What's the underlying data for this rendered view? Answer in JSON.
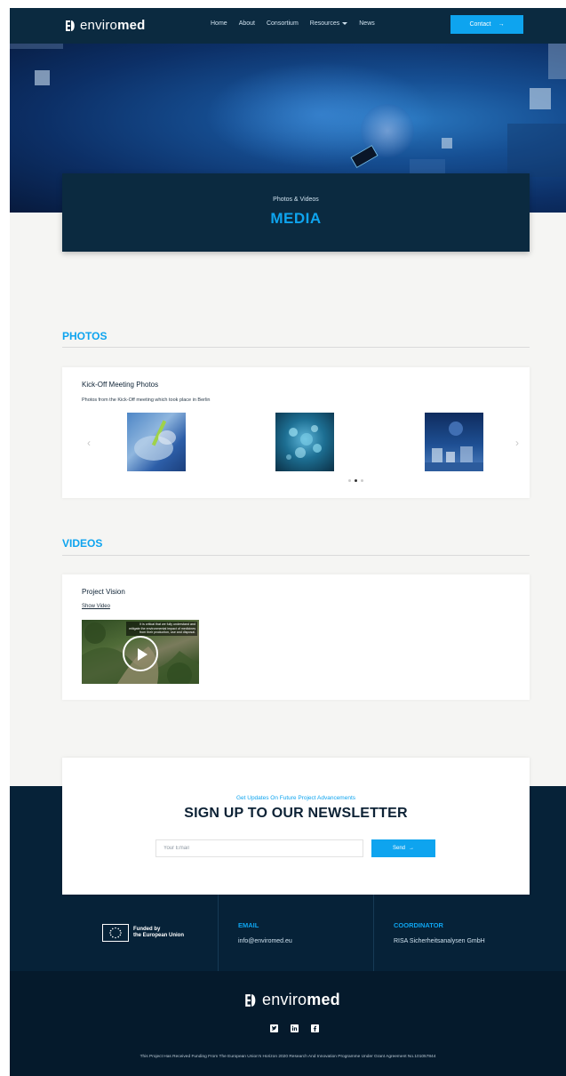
{
  "header": {
    "logo_text_light": "enviro",
    "logo_text_bold": "med",
    "nav": [
      {
        "label": "Home"
      },
      {
        "label": "About"
      },
      {
        "label": "Consortium"
      },
      {
        "label": "Resources"
      },
      {
        "label": "News"
      }
    ],
    "contact_label": "Contact",
    "contact_arrow": "→"
  },
  "hero": {
    "subtitle": "Photos & Videos",
    "title": "MEDIA"
  },
  "photos": {
    "section_title": "PHOTOS",
    "card_title": "Kick-Off Meeting Photos",
    "card_desc": "Photos from the Kick-Off meeting which took place in Berlin",
    "prev": "‹",
    "next": "›",
    "slides": 3,
    "active_slide": 2
  },
  "videos": {
    "section_title": "VIDEOS",
    "card_title": "Project Vision",
    "link_label": "Show Video",
    "thumb_caption": "It is critical that we fully understand and mitigate the environmental impact of medicines from their production, use and disposal."
  },
  "newsletter": {
    "subtitle": "Get Updates On Future Project Advancements",
    "title": "SIGN UP TO OUR NEWSLETTER",
    "placeholder": "Your Email",
    "send_label": "Send",
    "send_arrow": "→"
  },
  "footer": {
    "eu_line1": "Funded by",
    "eu_line2": "the European Union",
    "email_head": "EMAIL",
    "email": "info@enviromed.eu",
    "coord_head": "COORDINATOR",
    "coord": "RISA Sicherheitsanalysen GmbH",
    "logo_text_light": "enviro",
    "logo_text_bold": "med",
    "legal": "This Project Has Received Funding From The European Union's Horizon 2020 Research And Innovation Programme Under Grant Agreement No.101057844"
  },
  "colors": {
    "navy": "#0b2a40",
    "accent": "#0ea4ef",
    "background": "#f5f5f3"
  },
  "icons": [
    "enviromed-logo-icon",
    "caret-down-icon",
    "arrow-right-icon",
    "chevron-left-icon",
    "chevron-right-icon",
    "play-icon",
    "eu-flag-icon",
    "twitter-icon",
    "linkedin-icon",
    "facebook-icon"
  ]
}
